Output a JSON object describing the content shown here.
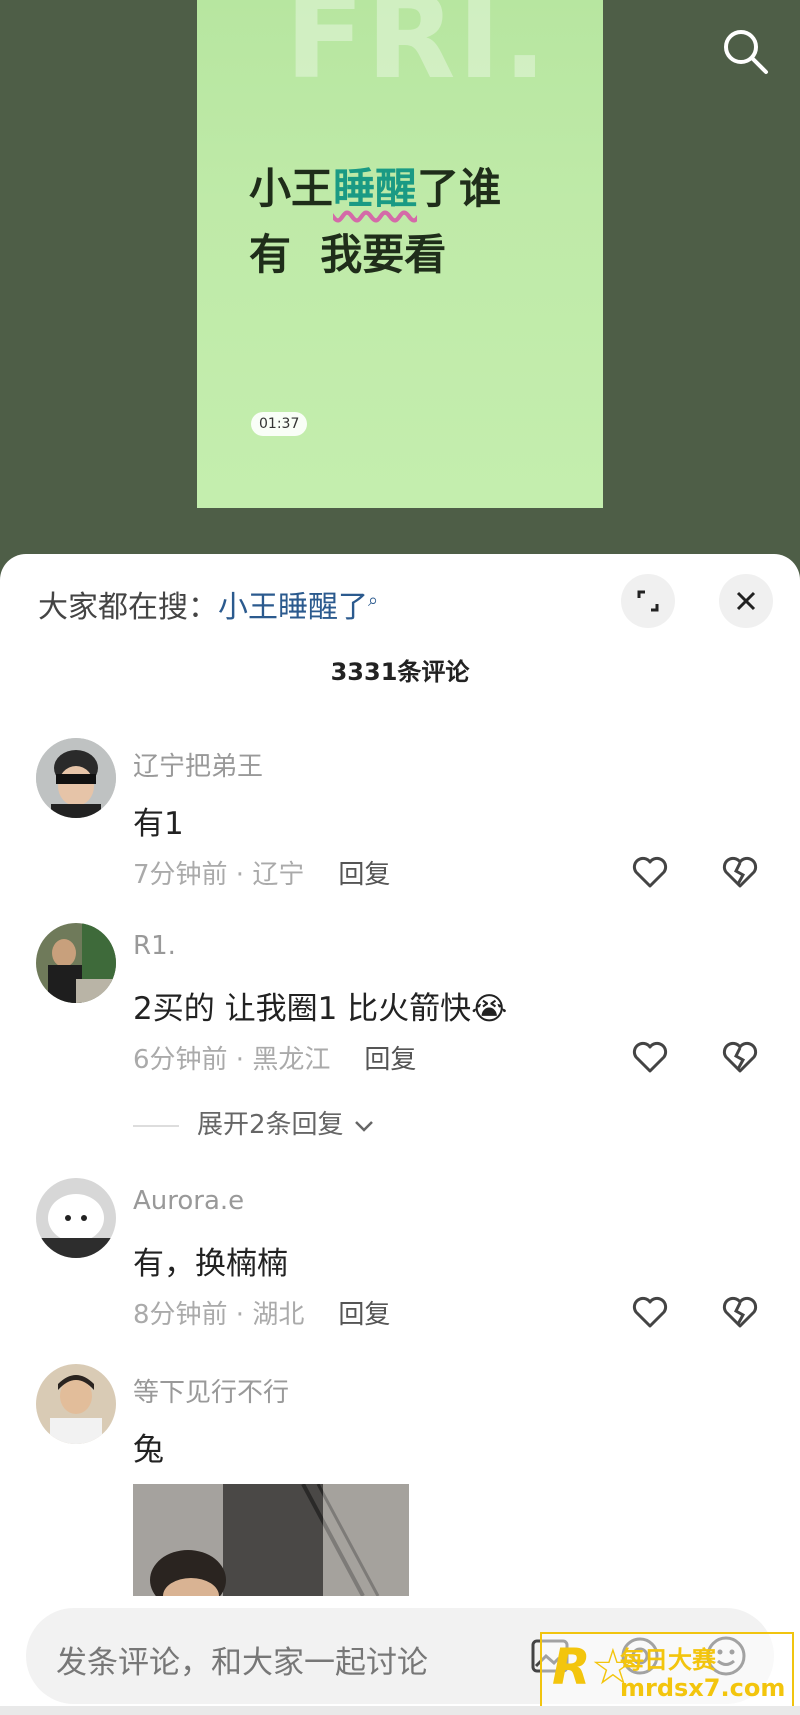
{
  "video": {
    "bg_text": "FRI.",
    "caption_line1_a": "小王",
    "caption_line1_b": "睡醒",
    "caption_line1_c": "了谁",
    "caption_line2": "有  我要看",
    "duration": "01:37"
  },
  "panel": {
    "hot_label": "大家都在搜：",
    "hot_term": "小王睡醒了",
    "comment_count": "3331条评论"
  },
  "comments": [
    {
      "user": "辽宁把弟王",
      "text": "有1",
      "time_loc": "7分钟前 · 辽宁",
      "reply": "回复"
    },
    {
      "user": "R1.",
      "text": "2买的 让我圈1 比火箭快😭",
      "time_loc": "6分钟前 · 黑龙江",
      "reply": "回复",
      "expand": "展开2条回复"
    },
    {
      "user": "Aurora.e",
      "text": "有，换楠楠",
      "time_loc": "8分钟前 · 湖北",
      "reply": "回复"
    },
    {
      "user": "等下见行不行",
      "text": "兔"
    }
  ],
  "input": {
    "placeholder": "发条评论，和大家一起讨论"
  },
  "watermark": {
    "line1": "每日大赛",
    "line2": "mrdsx7.com"
  },
  "icons": [
    "search-icon",
    "expand-icon",
    "close-icon",
    "heart-icon",
    "broken-heart-icon",
    "chevron-down-icon",
    "image-icon",
    "at-icon",
    "emoji-icon"
  ]
}
